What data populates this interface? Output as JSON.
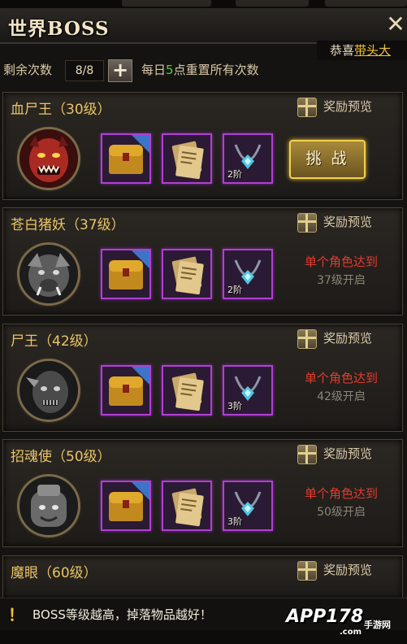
{
  "window": {
    "title": "世界BOSS",
    "close_symbol": "✕"
  },
  "ticker": {
    "prefix": "恭喜",
    "highlight": "带头大"
  },
  "counter": {
    "label": "剩余次数",
    "value": "8/8",
    "plus_symbol": "+",
    "reset_pre": "每日",
    "reset_num": "5",
    "reset_post": "点重置所有次数"
  },
  "reward_label": "奖励预览",
  "bosses": [
    {
      "name": "血尸王（30级）",
      "icon": "red-demon-icon",
      "tiers": [
        "",
        "",
        "2阶"
      ],
      "action": "挑 战",
      "locked": false
    },
    {
      "name": "苍白猪妖（37级）",
      "icon": "grey-boar-icon",
      "tiers": [
        "",
        "",
        "2阶"
      ],
      "req1": "单个角色达到",
      "req2": "37级开启",
      "locked": true
    },
    {
      "name": "尸王（42级）",
      "icon": "zombie-king-icon",
      "tiers": [
        "",
        "",
        "3阶"
      ],
      "req1": "单个角色达到",
      "req2": "42级开启",
      "locked": true
    },
    {
      "name": "招魂使（50级）",
      "icon": "soul-caller-icon",
      "tiers": [
        "",
        "",
        "3阶"
      ],
      "req1": "单个角色达到",
      "req2": "50级开启",
      "locked": true
    },
    {
      "name": "魔眼（60级）",
      "icon": "demon-eye-icon"
    }
  ],
  "item_icons": [
    "treasure-chest-icon",
    "scroll-icon",
    "gem-necklace-icon"
  ],
  "tip": {
    "icon": "exclamation-icon",
    "bang": "！",
    "text": "BOSS等级越高，掉落物品越好！"
  },
  "watermark": {
    "logo": "APP178",
    "cn": "手游网",
    "url": ".com"
  },
  "colors": {
    "accent_gold": "#e9c466",
    "item_border": "#b33fd4",
    "lock_red": "#e23b2e",
    "count_green": "#4ed43a"
  }
}
